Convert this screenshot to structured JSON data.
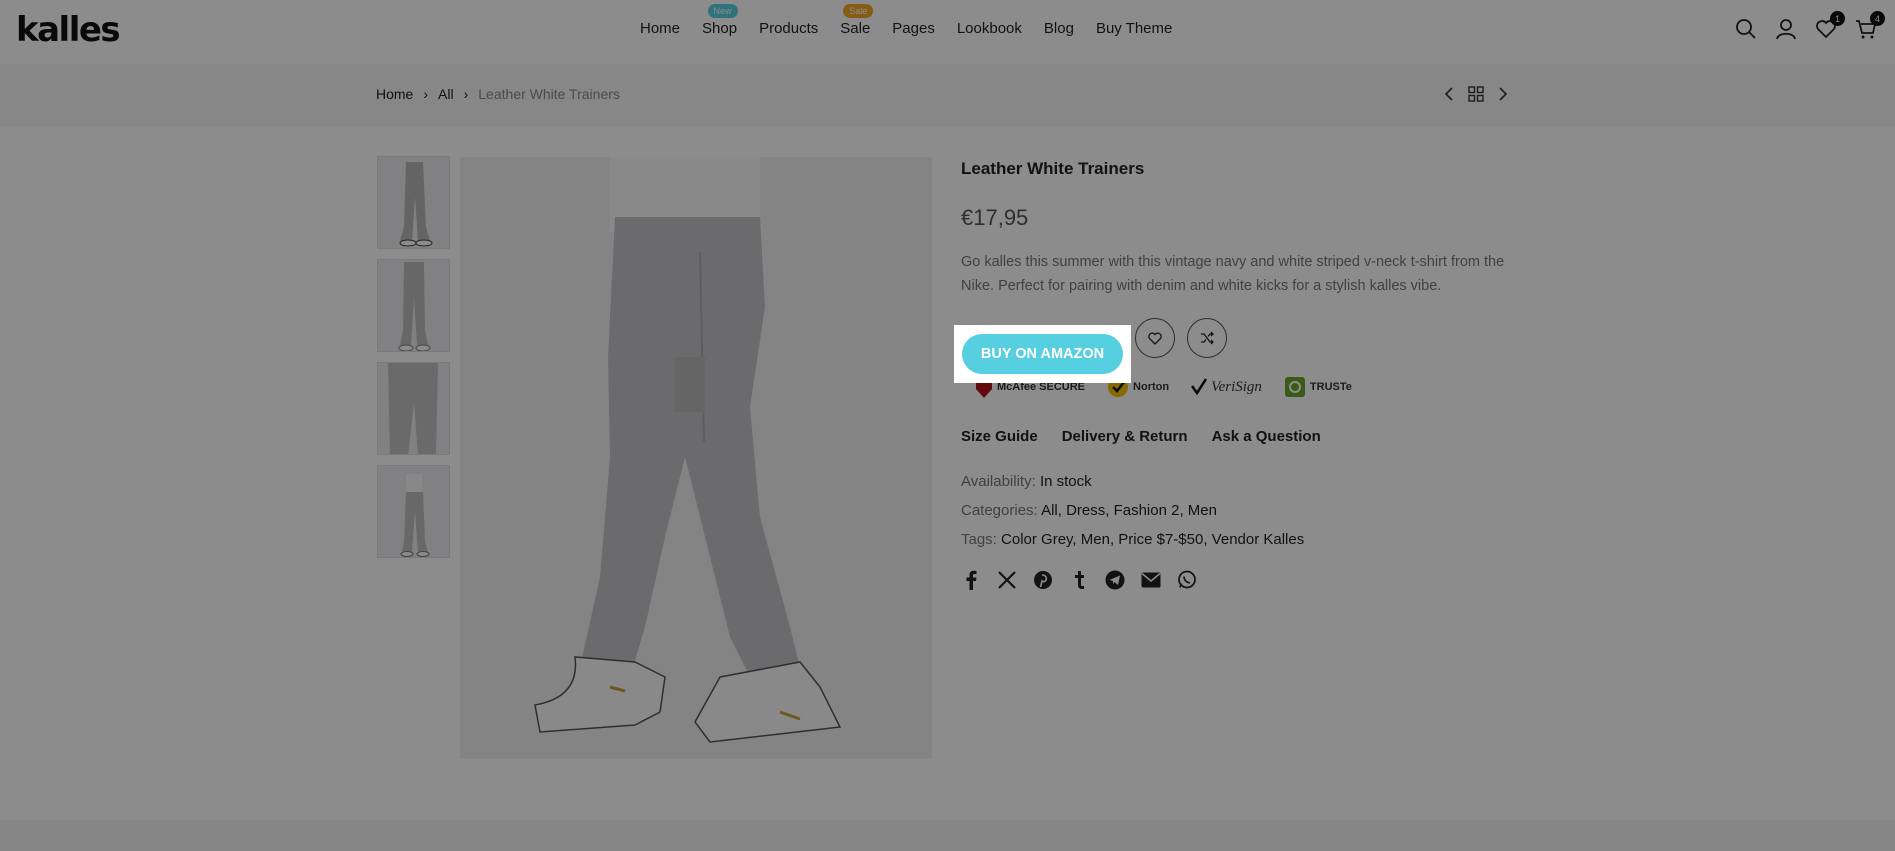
{
  "header": {
    "logo": "kalles",
    "nav": [
      {
        "label": "Home"
      },
      {
        "label": "Shop",
        "badge": "New",
        "badge_color": "#56cfe1"
      },
      {
        "label": "Products"
      },
      {
        "label": "Sale",
        "badge": "Sale",
        "badge_color": "#f5a623"
      },
      {
        "label": "Pages"
      },
      {
        "label": "Lookbook"
      },
      {
        "label": "Blog"
      },
      {
        "label": "Buy Theme"
      }
    ],
    "icons": [
      "search-icon",
      "account-icon",
      "wishlist-icon",
      "cart-icon"
    ],
    "wishlist_count": "1",
    "cart_count": "4"
  },
  "breadcrumb": {
    "items": [
      "Home",
      "All"
    ],
    "current": "Leather White Trainers"
  },
  "product": {
    "title": "Leather White Trainers",
    "price": "€17,95",
    "description": "Go kalles this summer with this vintage navy and white striped v-neck t-shirt from the Nike. Perfect for pairing with denim and white kicks for a stylish kalles vibe.",
    "buy_label": "BUY ON AMAZON",
    "trust_badges": [
      "McAfee SECURE",
      "Norton",
      "VeriSign",
      "TRUSTe"
    ],
    "links": [
      "Size Guide",
      "Delivery & Return",
      "Ask a Question"
    ],
    "availability_label": "Availability:",
    "availability": "In stock",
    "categories_label": "Categories:",
    "categories": "All, Dress, Fashion 2, Men",
    "tags_label": "Tags:",
    "tags": "Color Grey, Men, Price $7-$50, Vendor Kalles",
    "share": [
      "facebook-icon",
      "x-icon",
      "pinterest-icon",
      "tumblr-icon",
      "telegram-icon",
      "email-icon",
      "whatsapp-icon"
    ]
  },
  "colors": {
    "accent": "#56cfe1",
    "sale": "#f5a623"
  }
}
